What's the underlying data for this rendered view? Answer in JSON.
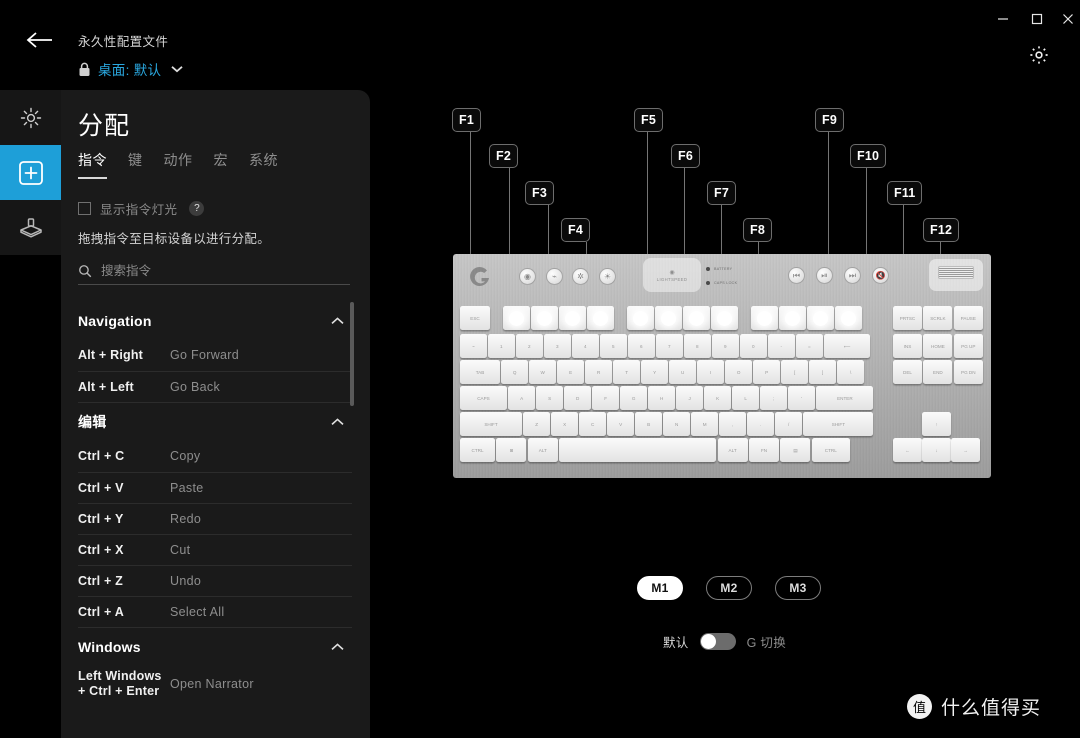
{
  "window": {
    "minimize": "—",
    "maximize": "□",
    "close": "×",
    "back_icon": "back-arrow-icon",
    "settings_icon": "gear-icon"
  },
  "profile": {
    "title": "永久性配置文件",
    "lock_icon": "lock-icon",
    "name": "桌面: 默认",
    "caret_icon": "chevron-down-icon",
    "accent": "#2aa8e0"
  },
  "rail": {
    "items": [
      {
        "icon": "lighting-icon",
        "active": false
      },
      {
        "icon": "plus-square-icon",
        "active": true
      },
      {
        "icon": "joystick-icon",
        "active": false
      }
    ],
    "active_color": "#1e9fd8"
  },
  "panel": {
    "title": "分配",
    "tabs": [
      {
        "label": "指令",
        "active": true
      },
      {
        "label": "键",
        "active": false
      },
      {
        "label": "动作",
        "active": false
      },
      {
        "label": "宏",
        "active": false
      },
      {
        "label": "系统",
        "active": false
      }
    ],
    "show_light_label": "显示指令灯光",
    "help_badge": "?",
    "drag_hint": "拖拽指令至目标设备以进行分配。",
    "search_placeholder": "搜索指令",
    "search_value": "",
    "search_icon": "search-icon"
  },
  "command_groups": [
    {
      "name": "Navigation",
      "collapse_icon": "chevron-up-icon",
      "rows": [
        {
          "keys": "Alt + Right",
          "desc": "Go Forward"
        },
        {
          "keys": "Alt + Left",
          "desc": "Go Back"
        }
      ]
    },
    {
      "name": "编辑",
      "collapse_icon": "chevron-up-icon",
      "rows": [
        {
          "keys": "Ctrl + C",
          "desc": "Copy"
        },
        {
          "keys": "Ctrl + V",
          "desc": "Paste"
        },
        {
          "keys": "Ctrl + Y",
          "desc": "Redo"
        },
        {
          "keys": "Ctrl + X",
          "desc": "Cut"
        },
        {
          "keys": "Ctrl + Z",
          "desc": "Undo"
        },
        {
          "keys": "Ctrl + A",
          "desc": "Select All"
        }
      ]
    },
    {
      "name": "Windows",
      "collapse_icon": "chevron-up-icon",
      "rows": [
        {
          "keys": "Left Windows + Ctrl + Enter",
          "desc": "Open Narrator"
        }
      ]
    }
  ],
  "keyboard": {
    "callouts": [
      {
        "label": "F1"
      },
      {
        "label": "F2"
      },
      {
        "label": "F3"
      },
      {
        "label": "F4"
      },
      {
        "label": "F5"
      },
      {
        "label": "F6"
      },
      {
        "label": "F7"
      },
      {
        "label": "F8"
      },
      {
        "label": "F9"
      },
      {
        "label": "F10"
      },
      {
        "label": "F11"
      },
      {
        "label": "F12"
      }
    ],
    "lightspeed_label": "LIGHTSPEED",
    "led_labels": [
      "BATTERY",
      "CAPS LOCK"
    ],
    "brand_icon": "logitech-g-logo",
    "top_buttons": [
      "game-mode-icon",
      "bluetooth-icon",
      "lighting-icon",
      "brightness-icon"
    ],
    "media_buttons": [
      "prev-track-icon",
      "play-pause-icon",
      "next-track-icon",
      "mute-icon"
    ],
    "rows": {
      "fn_row": [
        "ESC",
        "F1",
        "F2",
        "F3",
        "F4",
        "F5",
        "F6",
        "F7",
        "F8",
        "F9",
        "F10",
        "F11",
        "F12",
        "PRTSC",
        "SCRLK",
        "PAUSE"
      ],
      "num_row": [
        "~",
        "1",
        "2",
        "3",
        "4",
        "5",
        "6",
        "7",
        "8",
        "9",
        "0",
        "-",
        "=",
        "⟵",
        "INS",
        "HOME",
        "PG UP"
      ],
      "q_row": [
        "TAB",
        "Q",
        "W",
        "E",
        "R",
        "T",
        "Y",
        "U",
        "I",
        "O",
        "P",
        "[",
        "]",
        "\\",
        "DEL",
        "END",
        "PG DN"
      ],
      "a_row": [
        "CAPS",
        "A",
        "S",
        "D",
        "F",
        "G",
        "H",
        "J",
        "K",
        "L",
        ";",
        "'",
        "ENTER"
      ],
      "z_row": [
        "SHIFT",
        "Z",
        "X",
        "C",
        "V",
        "B",
        "N",
        "M",
        ",",
        ".",
        "/",
        "SHIFT",
        "↑"
      ],
      "space_row": [
        "CTRL",
        "⊞",
        "ALT",
        "",
        "ALT",
        "FN",
        "▤",
        "CTRL",
        "←",
        "↓",
        "→"
      ]
    },
    "lit_keys": [
      "F1",
      "F2",
      "F3",
      "F4",
      "F5",
      "F6",
      "F7",
      "F8",
      "F9",
      "F10",
      "F11",
      "F12"
    ]
  },
  "modes": {
    "buttons": [
      {
        "label": "M1",
        "active": true
      },
      {
        "label": "M2",
        "active": false
      },
      {
        "label": "M3",
        "active": false
      }
    ]
  },
  "toggle": {
    "left_label": "默认",
    "right_label": "G 切换",
    "on": false
  },
  "watermark": {
    "logo": "值",
    "text": "什么值得买"
  }
}
